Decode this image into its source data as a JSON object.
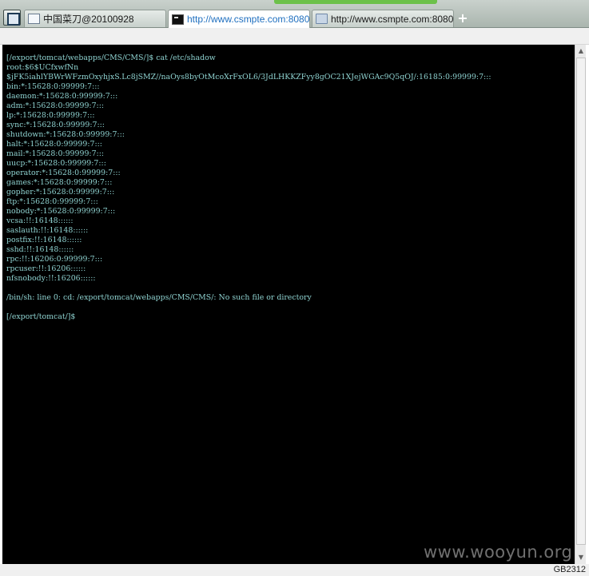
{
  "tabs": [
    {
      "title": "中国菜刀@20100928",
      "icon": "page-icon"
    },
    {
      "title": "http://www.csmpte.com:8080...",
      "icon": "terminal-icon"
    },
    {
      "title": "http://www.csmpte.com:8080...",
      "icon": "folder-icon"
    }
  ],
  "new_tab_label": "+",
  "terminal": {
    "lines": [
      "[/export/tomcat/webapps/CMS/CMS/]$ cat /etc/shadow",
      "root:$6$UCfxwfNn",
      "$jFK5iahlYBWrWFzmOxyhjxS.Lc8jSMZ//naOys8byOtMcoXrFxOL6/3JdLHKKZFyy8gOC21XJejWGAc9Q5qOJ/:16185:0:99999:7:::",
      "bin:*:15628:0:99999:7:::",
      "daemon:*:15628:0:99999:7:::",
      "adm:*:15628:0:99999:7:::",
      "lp:*:15628:0:99999:7:::",
      "sync:*:15628:0:99999:7:::",
      "shutdown:*:15628:0:99999:7:::",
      "halt:*:15628:0:99999:7:::",
      "mail:*:15628:0:99999:7:::",
      "uucp:*:15628:0:99999:7:::",
      "operator:*:15628:0:99999:7:::",
      "games:*:15628:0:99999:7:::",
      "gopher:*:15628:0:99999:7:::",
      "ftp:*:15628:0:99999:7:::",
      "nobody:*:15628:0:99999:7:::",
      "vcsa:!!:16148::::::",
      "saslauth:!!:16148::::::",
      "postfix:!!:16148::::::",
      "sshd:!!:16148::::::",
      "rpc:!!:16206:0:99999:7:::",
      "rpcuser:!!:16206::::::",
      "nfsnobody:!!:16206::::::",
      "",
      "/bin/sh: line 0: cd: /export/tomcat/webapps/CMS/CMS/: No such file or directory",
      "",
      "[/export/tomcat/]$"
    ]
  },
  "status_bar": {
    "encoding": "GB2312"
  },
  "watermark": "www.wooyun.org",
  "colors": {
    "terminal_background": "#000000",
    "terminal_text": "#8fd3d1",
    "active_tab_text": "#1f6fbf",
    "progress_strip": "#6cc14a"
  }
}
